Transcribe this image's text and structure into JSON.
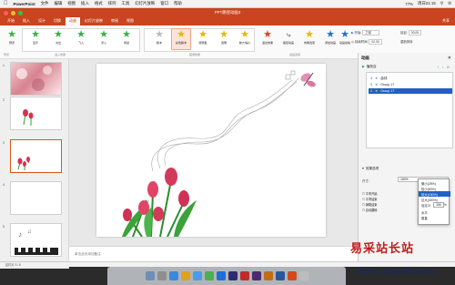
{
  "menubar": {
    "app": "PowerPoint",
    "items": [
      "文件",
      "编辑",
      "视图",
      "插入",
      "格式",
      "排列",
      "工具",
      "幻灯片放映",
      "窗口",
      "帮助"
    ],
    "right": [
      "77%",
      "周日21:15"
    ]
  },
  "window": {
    "title": "PPT路径动画3"
  },
  "tabs": [
    "开始",
    "插入",
    "设计",
    "切换",
    "动画",
    "幻灯片放映",
    "审阅",
    "视图"
  ],
  "share": "共享",
  "ribbon": {
    "preview": "预览",
    "entrance_effects": [
      "显示",
      "淡出",
      "飞入",
      "浮入",
      "劈裂"
    ],
    "emphasis_effects": [
      "脉冲",
      "彩色脉冲",
      "跷跷板",
      "透明",
      "放大/缩小"
    ],
    "buttons": [
      "退出效果",
      "路径动画",
      "效果选项",
      "添加动画",
      "动画窗格",
      "重新排序"
    ],
    "start_label": "开始:",
    "start_value": "之前",
    "duration_label": "持续时间:",
    "duration_value": "02.00",
    "delay_label": "延迟:",
    "delay_value": "00.00",
    "groups": [
      "预览",
      "进入效果",
      "强调效果",
      "动画选项",
      "计时"
    ]
  },
  "slides": [
    {
      "num": "1"
    },
    {
      "num": "2"
    },
    {
      "num": "3"
    },
    {
      "num": "4"
    },
    {
      "num": "5"
    }
  ],
  "notes_placeholder": "单击此处添加备注",
  "animation_pane": {
    "title": "动画",
    "play": "播放自",
    "items": [
      {
        "index": "1",
        "name": "曲线"
      },
      {
        "index": "1",
        "name": "Group 17"
      },
      {
        "index": "1",
        "name": "Group 17"
      }
    ],
    "effect_options": "效果选项",
    "size_label": "尺寸:",
    "size_value": "150%",
    "dropdown": [
      "微小(25%)",
      "较小(50%)",
      "较大(150%)",
      "巨大(400%)",
      "自定义:"
    ],
    "custom_value": "150",
    "custom_unit": "%",
    "extra": [
      "水平",
      "垂直"
    ],
    "checks": [
      "平滑开始",
      "平滑结束",
      "弹跳结束",
      "自动翻转"
    ]
  },
  "status": {
    "left": "幻灯片 3 / 5"
  },
  "watermark": {
    "cn": "易采站长站",
    "url": "www.easck.com"
  }
}
